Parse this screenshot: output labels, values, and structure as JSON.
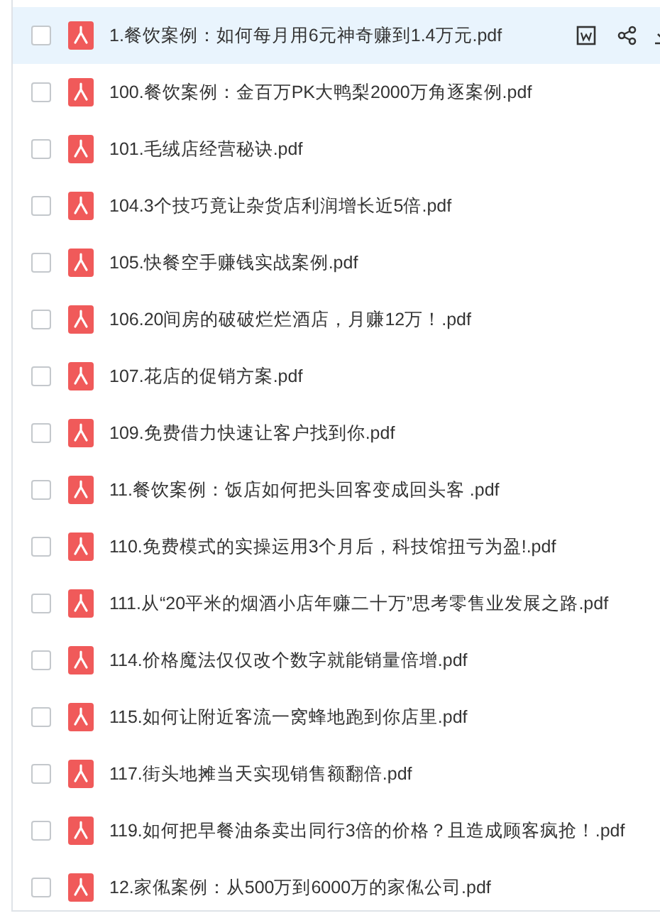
{
  "files": [
    {
      "name": "1.餐饮案例：如何每月用6元神奇赚到1.4万元.pdf",
      "selected": true,
      "checked": false
    },
    {
      "name": "100.餐饮案例：金百万PK大鸭梨2000万角逐案例.pdf",
      "selected": false,
      "checked": false
    },
    {
      "name": "101.毛绒店经营秘诀.pdf",
      "selected": false,
      "checked": false
    },
    {
      "name": "104.3个技巧竟让杂货店利润增长近5倍.pdf",
      "selected": false,
      "checked": false
    },
    {
      "name": "105.快餐空手赚钱实战案例.pdf",
      "selected": false,
      "checked": false
    },
    {
      "name": "106.20间房的破破烂烂酒店，月赚12万！.pdf",
      "selected": false,
      "checked": false
    },
    {
      "name": "107.花店的促销方案.pdf",
      "selected": false,
      "checked": false
    },
    {
      "name": "109.免费借力快速让客户找到你.pdf",
      "selected": false,
      "checked": false
    },
    {
      "name": "11.餐饮案例：饭店如何把头回客变成回头客 .pdf",
      "selected": false,
      "checked": false
    },
    {
      "name": "110.免费模式的实操运用3个月后，科技馆扭亏为盈!.pdf",
      "selected": false,
      "checked": false
    },
    {
      "name": "111.从“20平米的烟酒小店年赚二十万”思考零售业发展之路.pdf",
      "selected": false,
      "checked": false
    },
    {
      "name": "114.价格魔法仅仅改个数字就能销量倍增.pdf",
      "selected": false,
      "checked": false
    },
    {
      "name": "115.如何让附近客流一窝蜂地跑到你店里.pdf",
      "selected": false,
      "checked": false
    },
    {
      "name": "117.街头地摊当天实现销售额翻倍.pdf",
      "selected": false,
      "checked": false
    },
    {
      "name": "119.如何把早餐油条卖出同行3倍的价格？且造成顾客疯抢！.pdf",
      "selected": false,
      "checked": false
    },
    {
      "name": "12.家俬案例：从500万到6000万的家俬公司.pdf",
      "selected": false,
      "checked": false
    }
  ]
}
